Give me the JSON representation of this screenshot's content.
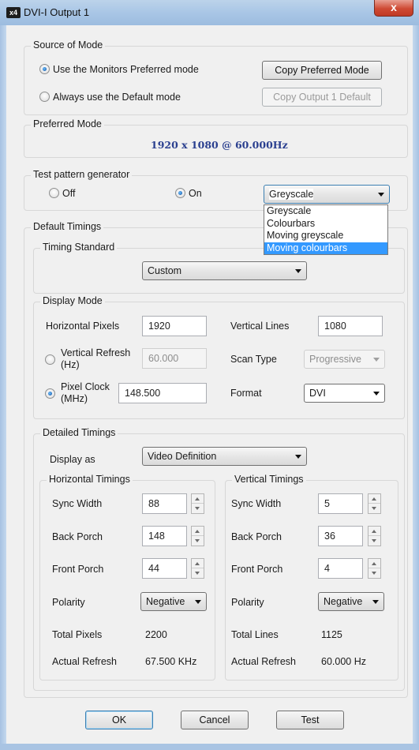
{
  "window": {
    "app_icon": "x4",
    "title": "DVI-I Output 1",
    "close": "x"
  },
  "source": {
    "title": "Source of Mode",
    "opt_preferred": "Use the Monitors Preferred mode",
    "opt_default": "Always use the Default mode",
    "copy_preferred": "Copy Preferred Mode",
    "copy_default": "Copy Output 1 Default"
  },
  "preferred": {
    "title": "Preferred Mode",
    "value": "1920 x 1080 @ 60.000Hz"
  },
  "test": {
    "title": "Test pattern generator",
    "off": "Off",
    "on": "On",
    "selected": "Greyscale",
    "options": [
      "Greyscale",
      "Colourbars",
      "Moving greyscale",
      "Moving colourbars"
    ]
  },
  "timings": {
    "title": "Default Timings",
    "standard": {
      "title": "Timing Standard",
      "value": "Custom"
    },
    "display": {
      "title": "Display Mode",
      "hpix_label": "Horizontal Pixels",
      "hpix": "1920",
      "vlines_label": "Vertical Lines",
      "vlines": "1080",
      "vrefresh_label": "Vertical Refresh",
      "vrefresh_unit": "(Hz)",
      "vrefresh": "60.000",
      "scan_label": "Scan Type",
      "scan": "Progressive",
      "pclk_label": "Pixel Clock",
      "pclk_unit": "(MHz)",
      "pclk": "148.500",
      "format_label": "Format",
      "format": "DVI"
    },
    "detailed": {
      "title": "Detailed Timings",
      "display_as_label": "Display as",
      "display_as": "Video Definition",
      "h": {
        "title": "Horizontal Timings",
        "sync_label": "Sync Width",
        "sync": "88",
        "back_label": "Back Porch",
        "back": "148",
        "front_label": "Front Porch",
        "front": "44",
        "pol_label": "Polarity",
        "pol": "Negative",
        "total_label": "Total Pixels",
        "total": "2200",
        "refresh_label": "Actual Refresh",
        "refresh": "67.500 KHz"
      },
      "v": {
        "title": "Vertical Timings",
        "sync_label": "Sync Width",
        "sync": "5",
        "back_label": "Back Porch",
        "back": "36",
        "front_label": "Front Porch",
        "front": "4",
        "pol_label": "Polarity",
        "pol": "Negative",
        "total_label": "Total Lines",
        "total": "1125",
        "refresh_label": "Actual Refresh",
        "refresh": "60.000 Hz"
      }
    }
  },
  "buttons": {
    "ok": "OK",
    "cancel": "Cancel",
    "test": "Test"
  },
  "colors": {
    "titlebar": "#a9c6e6",
    "close": "#c9432d",
    "highlight": "#3399ff",
    "preferred_text": "#2a3f8f"
  }
}
